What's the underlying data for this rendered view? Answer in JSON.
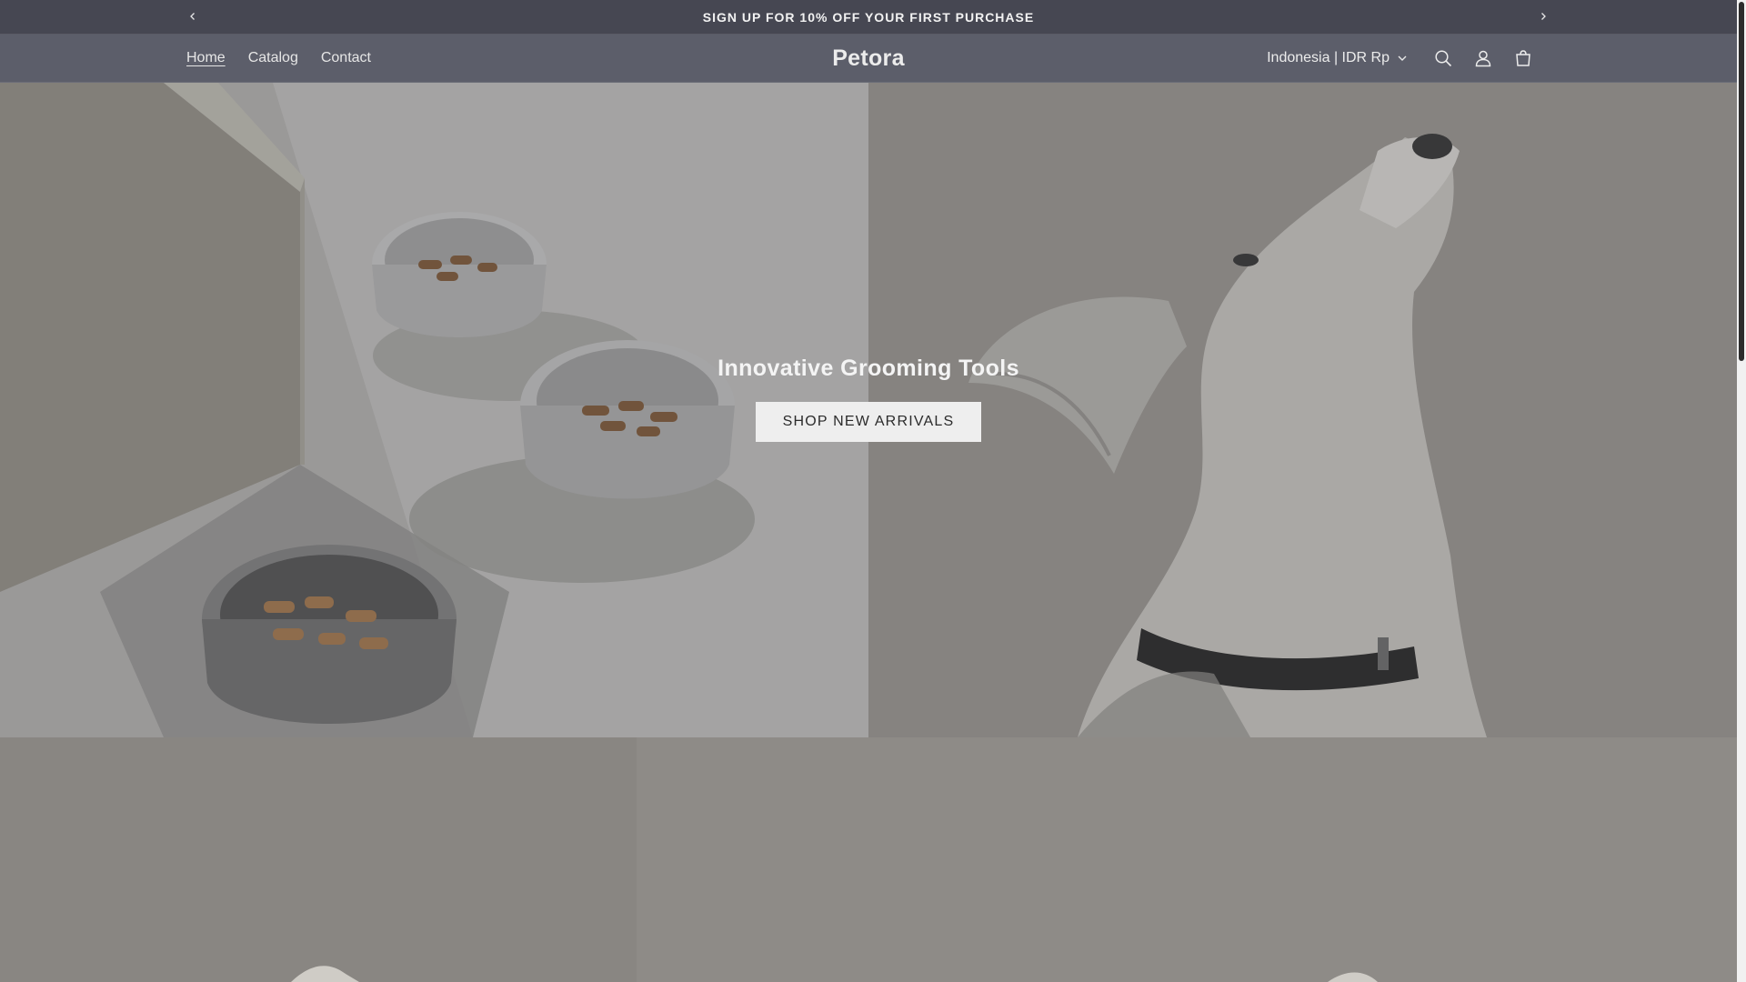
{
  "announcement": {
    "text": "SIGN UP FOR 10% OFF YOUR FIRST PURCHASE",
    "prev_icon": "chevron-left-icon",
    "next_icon": "chevron-right-icon"
  },
  "header": {
    "logo": "Petora",
    "nav": [
      {
        "label": "Home",
        "active": true
      },
      {
        "label": "Catalog",
        "active": false
      },
      {
        "label": "Contact",
        "active": false
      }
    ],
    "locale": "Indonesia | IDR Rp",
    "icons": [
      "search-icon",
      "account-icon",
      "cart-icon"
    ]
  },
  "hero": {
    "title": "Innovative Grooming Tools",
    "button_label": "SHOP NEW ARRIVALS",
    "left_image": "pet-bowls-with-treats-photo",
    "right_image": "dog-looking-up-photo"
  },
  "colors": {
    "announcement_bg": "#464752",
    "header_bg": "#5c5e6a",
    "button_bg": "#eeeeee"
  }
}
